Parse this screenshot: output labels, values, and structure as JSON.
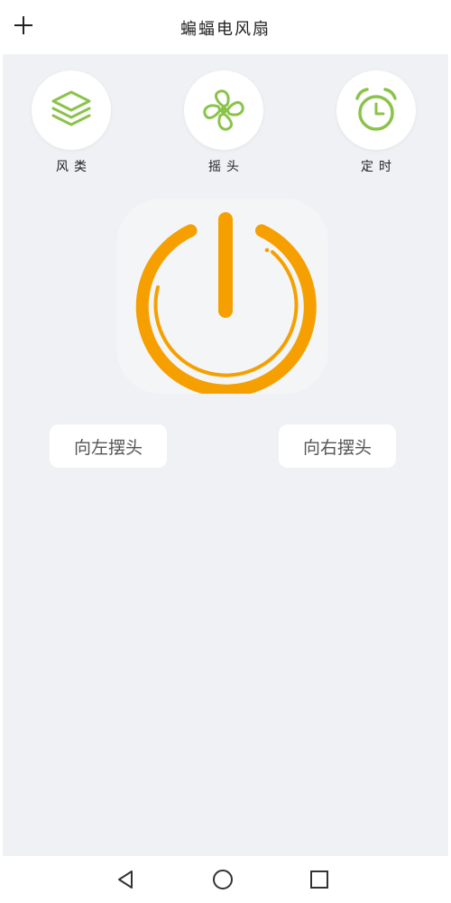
{
  "header": {
    "title": "蝙蝠电风扇",
    "add_icon": "plus-icon"
  },
  "features": [
    {
      "label": "风类",
      "icon": "layers-icon"
    },
    {
      "label": "摇头",
      "icon": "fan-icon"
    },
    {
      "label": "定时",
      "icon": "alarm-clock-icon"
    }
  ],
  "power": {
    "icon": "power-icon"
  },
  "controls": {
    "swing_left_label": "向左摆头",
    "swing_right_label": "向右摆头"
  },
  "system_nav": {
    "back_icon": "back-triangle-icon",
    "home_icon": "home-circle-icon",
    "recents_icon": "recents-square-icon"
  },
  "colors": {
    "accent_green": "#8bc34a",
    "power_orange": "#f5a000",
    "background": "#f0f1f5"
  }
}
